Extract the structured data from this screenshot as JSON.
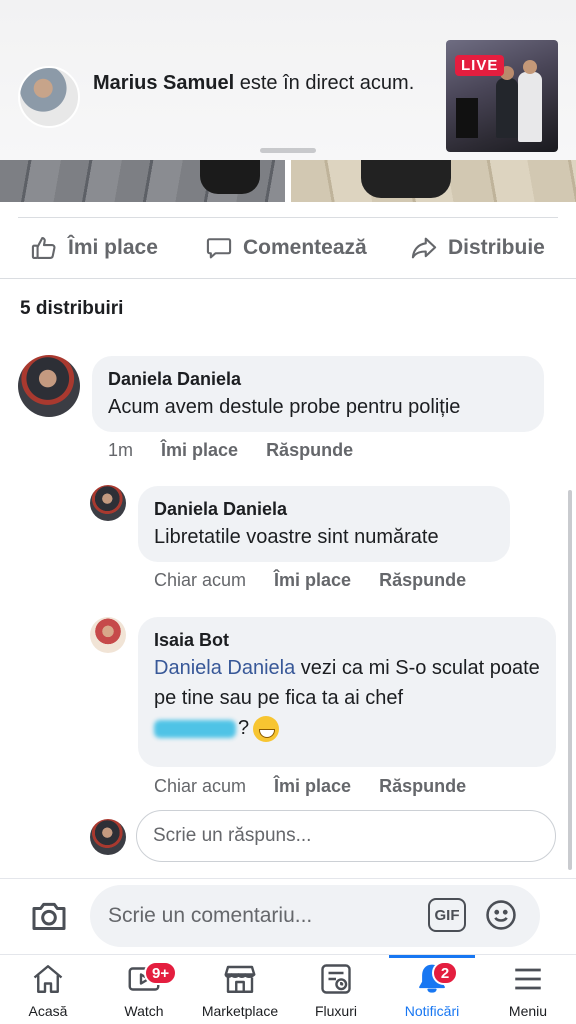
{
  "live_banner": {
    "name": "Marius Samuel",
    "text": " este în direct acum.",
    "badge": "LIVE"
  },
  "actions": {
    "like": "Îmi place",
    "comment": "Comentează",
    "share": "Distribuie"
  },
  "shares_count": "5 distribuiri",
  "comments": [
    {
      "author": "Daniela Daniela",
      "text": "Acum avem destule probe pentru poliție",
      "time": "1m",
      "like": "Îmi place",
      "reply": "Răspunde"
    },
    {
      "author": "Daniela Daniela",
      "text": "Libretatile voastre sint numărate",
      "time": "Chiar acum",
      "like": "Îmi place",
      "reply": "Răspunde"
    },
    {
      "author": "Isaia Bot",
      "mention": "Daniela Daniela",
      "text": " vezi ca mi S-o sculat poate pe tine sau pe fica ta ai chef",
      "text_end": "?",
      "time": "Chiar acum",
      "like": "Îmi place",
      "reply": "Răspunde"
    }
  ],
  "reply_placeholder": "Scrie un răspuns...",
  "composer_placeholder": "Scrie un comentariu...",
  "gif_label": "GIF",
  "nav": [
    {
      "label": "Acasă",
      "icon": "home-icon"
    },
    {
      "label": "Watch",
      "icon": "watch-icon",
      "badge": "9+"
    },
    {
      "label": "Marketplace",
      "icon": "marketplace-icon"
    },
    {
      "label": "Fluxuri",
      "icon": "feeds-icon"
    },
    {
      "label": "Notificări",
      "icon": "bell-icon",
      "badge": "2",
      "active": true
    },
    {
      "label": "Meniu",
      "icon": "menu-icon"
    }
  ],
  "colors": {
    "accent": "#1877f2",
    "badge": "#e41e3f",
    "mention": "#385898",
    "bubble": "#f0f2f5"
  }
}
